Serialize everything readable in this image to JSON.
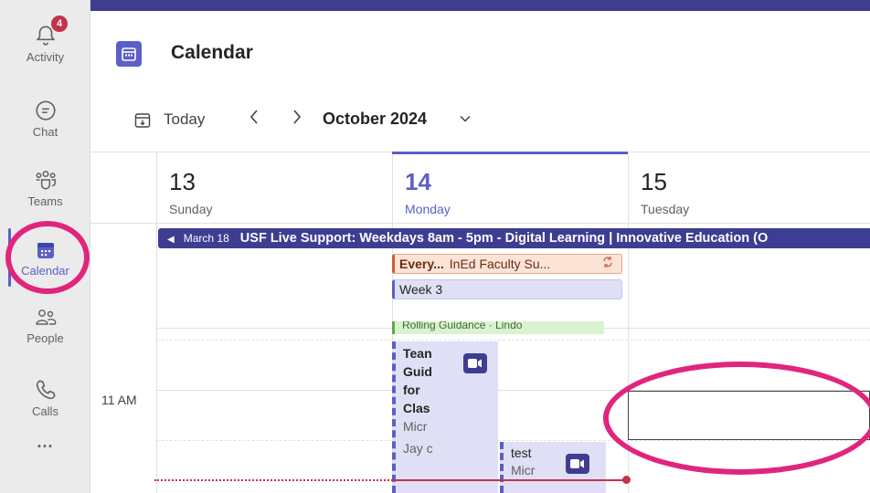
{
  "rail": {
    "items": [
      {
        "label": "Activity",
        "badge": "4"
      },
      {
        "label": "Chat"
      },
      {
        "label": "Teams"
      },
      {
        "label": "Calendar"
      },
      {
        "label": "People"
      },
      {
        "label": "Calls"
      },
      {
        "label": "..."
      }
    ]
  },
  "header": {
    "title": "Calendar"
  },
  "toolbar": {
    "today": "Today",
    "prev": "<",
    "next": ">",
    "month": "October 2024"
  },
  "days": [
    {
      "num": "13",
      "name": "Sunday"
    },
    {
      "num": "14",
      "name": "Monday"
    },
    {
      "num": "15",
      "name": "Tuesday"
    }
  ],
  "allday": {
    "banner_date": "March 18",
    "banner_title": "USF Live Support: Weekdays 8am - 5pm - Digital Learning | Innovative Education (O",
    "every_bold": "Every...",
    "every_rest": "InEd Faculty Su...",
    "week": "Week 3"
  },
  "times": {
    "eleven": "11 AM"
  },
  "events": {
    "partial_green": "Rolling Guidance · Lindo",
    "team": [
      "Tean",
      "Guid",
      "for",
      "Clas"
    ],
    "team_sub": [
      "Micr",
      "Jay c"
    ],
    "test": "test",
    "test_sub": "Micr"
  },
  "colors": {
    "accent": "#5b5fc7",
    "banner": "#3d3e92",
    "annotation": "#e0257d",
    "now": "#c4314b"
  }
}
